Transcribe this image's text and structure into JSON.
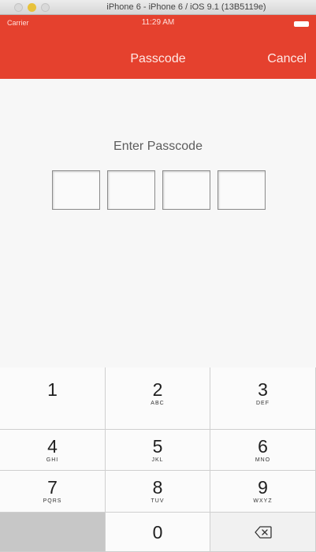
{
  "window": {
    "title": "iPhone 6 - iPhone 6 / iOS 9.1 (13B5119e)"
  },
  "status_bar": {
    "carrier": "Carrier",
    "time": "11:29 AM"
  },
  "nav": {
    "title": "Passcode",
    "cancel_label": "Cancel"
  },
  "main": {
    "prompt": "Enter Passcode",
    "passcode_boxes": 4
  },
  "keypad": {
    "keys": [
      {
        "digit": "1",
        "letters": ""
      },
      {
        "digit": "2",
        "letters": "ABC"
      },
      {
        "digit": "3",
        "letters": "DEF"
      },
      {
        "digit": "4",
        "letters": "GHI"
      },
      {
        "digit": "5",
        "letters": "JKL"
      },
      {
        "digit": "6",
        "letters": "MNO"
      },
      {
        "digit": "7",
        "letters": "PQRS"
      },
      {
        "digit": "8",
        "letters": "TUV"
      },
      {
        "digit": "9",
        "letters": "WXYZ"
      },
      {
        "digit": "0",
        "letters": ""
      }
    ],
    "delete_icon": "backspace-icon"
  },
  "colors": {
    "nav_background": "#e5412e",
    "keypad_background": "#fbfbfb"
  }
}
